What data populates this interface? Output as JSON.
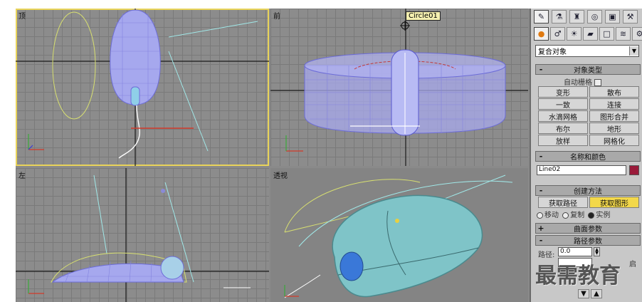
{
  "viewports": {
    "top": {
      "label": "顶"
    },
    "front": {
      "label": "前"
    },
    "left": {
      "label": "左"
    },
    "perspective": {
      "label": "透视"
    }
  },
  "object_tag": "Circle01",
  "panel": {
    "tabs": [
      "create-tab",
      "modify-tab",
      "hierarchy-tab",
      "motion-tab",
      "display-tab",
      "utilities-tab"
    ],
    "subtabs": [
      "geometry",
      "shapes",
      "lights",
      "cameras",
      "helpers",
      "space-warps",
      "systems"
    ],
    "category_dropdown": "复合对象",
    "object_type": {
      "header": "对象类型",
      "autogrid": "自动栅格",
      "buttons": [
        "变形",
        "散布",
        "一致",
        "连接",
        "水滴网格",
        "图形合并",
        "布尔",
        "地形",
        "放样",
        "网格化"
      ]
    },
    "name_color": {
      "header": "名称和颜色",
      "name": "Line02",
      "color": "#9a1a3a"
    },
    "creation_method": {
      "header": "创建方法",
      "get_path": "获取路径",
      "get_shape": "获取图形",
      "move": "移动",
      "copy": "复制",
      "instance": "实例"
    },
    "surface_params": {
      "header": "曲面参数"
    },
    "path_params": {
      "header": "路径参数",
      "path_label": "路径:",
      "path_value": "0.0",
      "snap_label": "启"
    }
  },
  "watermark": "最需教育"
}
